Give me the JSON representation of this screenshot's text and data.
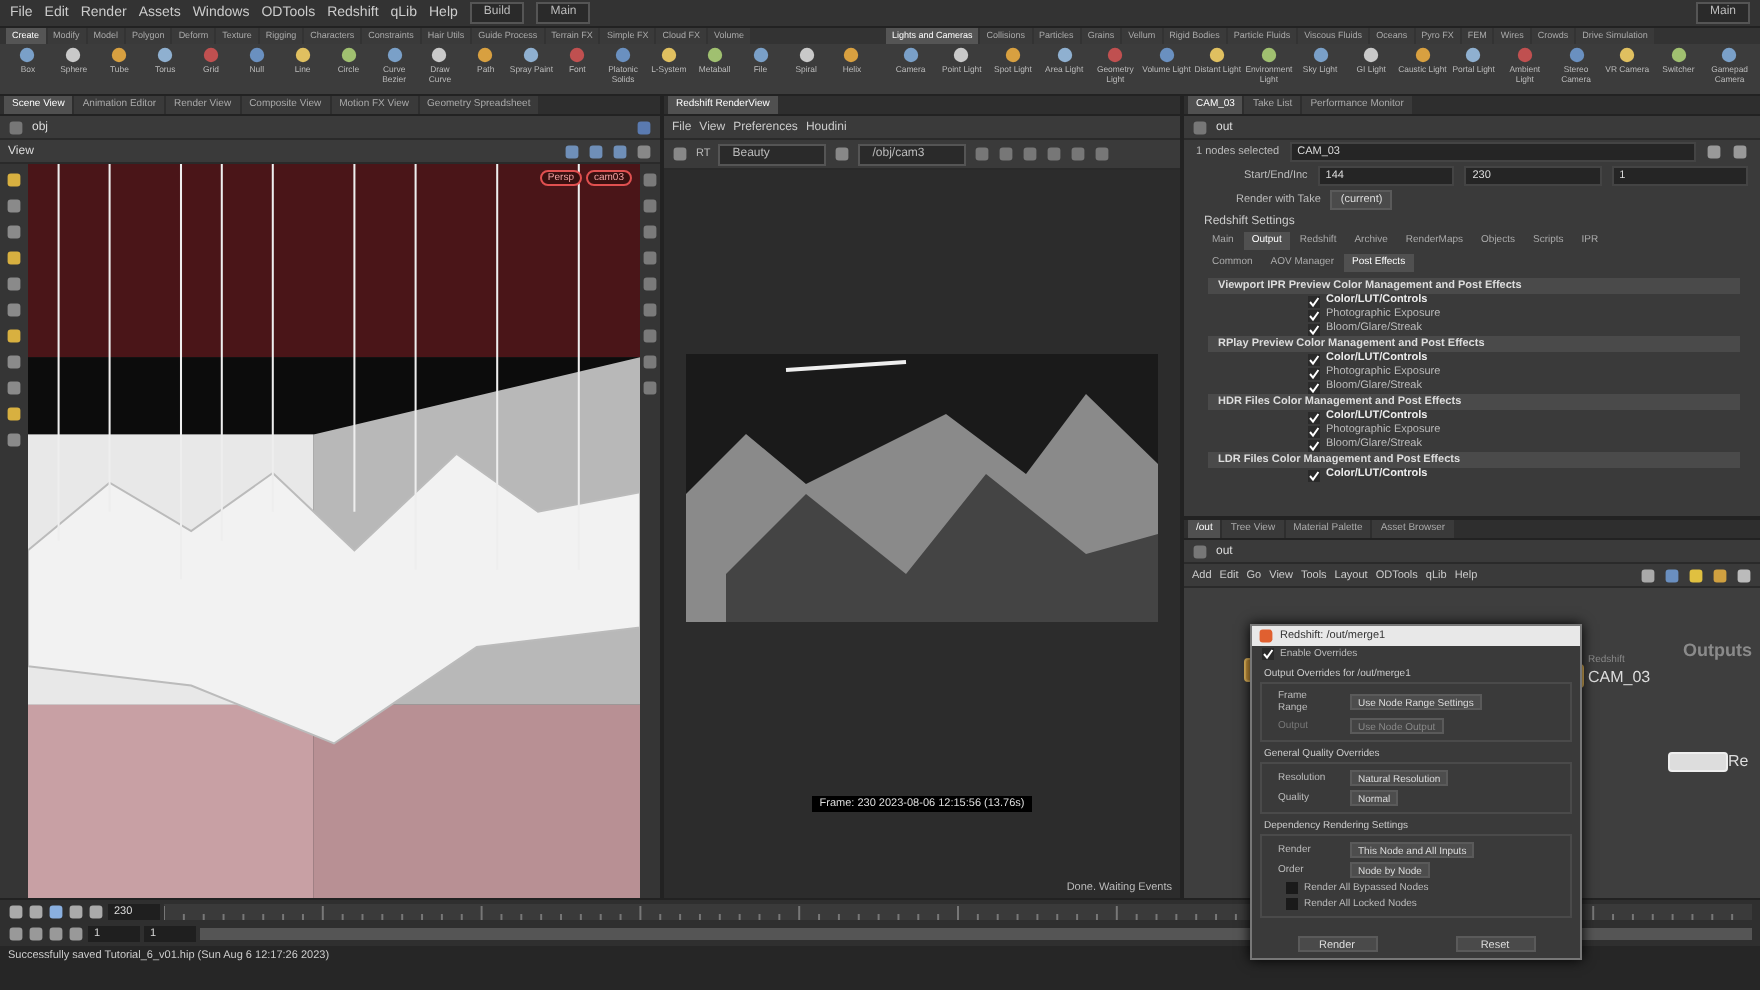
{
  "menubar": {
    "items": [
      "File",
      "Edit",
      "Render",
      "Assets",
      "Windows",
      "ODTools",
      "Redshift",
      "qLib",
      "Help"
    ],
    "desktop": "Build",
    "context": "Main",
    "right_context": "Main"
  },
  "shelf_left": {
    "tabs": [
      {
        "label": "Create",
        "selected": true
      },
      {
        "label": "Modify",
        "selected": false
      },
      {
        "label": "Model",
        "selected": false
      },
      {
        "label": "Polygon",
        "selected": false
      },
      {
        "label": "Deform",
        "selected": false
      },
      {
        "label": "Texture",
        "selected": false
      },
      {
        "label": "Rigging",
        "selected": false
      },
      {
        "label": "Characters",
        "selected": false
      },
      {
        "label": "Constraints",
        "selected": false
      },
      {
        "label": "Hair Utils",
        "selected": false
      },
      {
        "label": "Guide Process",
        "selected": false
      },
      {
        "label": "Terrain FX",
        "selected": false
      },
      {
        "label": "Simple FX",
        "selected": false
      },
      {
        "label": "Cloud FX",
        "selected": false
      },
      {
        "label": "Volume",
        "selected": false
      }
    ],
    "tools": [
      "Box",
      "Sphere",
      "Tube",
      "Torus",
      "Grid",
      "Null",
      "Line",
      "Circle",
      "Curve Bezier",
      "Draw Curve",
      "Path",
      "Spray Paint",
      "Font",
      "Platonic Solids",
      "L-System",
      "Metaball",
      "File",
      "Spiral",
      "Helix"
    ]
  },
  "shelf_right": {
    "tabs": [
      {
        "label": "Lights and Cameras",
        "selected": true
      },
      {
        "label": "Collisions",
        "selected": false
      },
      {
        "label": "Particles",
        "selected": false
      },
      {
        "label": "Grains",
        "selected": false
      },
      {
        "label": "Vellum",
        "selected": false
      },
      {
        "label": "Rigid Bodies",
        "selected": false
      },
      {
        "label": "Particle Fluids",
        "selected": false
      },
      {
        "label": "Viscous Fluids",
        "selected": false
      },
      {
        "label": "Oceans",
        "selected": false
      },
      {
        "label": "Pyro FX",
        "selected": false
      },
      {
        "label": "FEM",
        "selected": false
      },
      {
        "label": "Wires",
        "selected": false
      },
      {
        "label": "Crowds",
        "selected": false
      },
      {
        "label": "Drive Simulation",
        "selected": false
      }
    ],
    "tools": [
      "Camera",
      "Point Light",
      "Spot Light",
      "Area Light",
      "Geometry Light",
      "Volume Light",
      "Distant Light",
      "Environment Light",
      "Sky Light",
      "GI Light",
      "Caustic Light",
      "Portal Light",
      "Ambient Light",
      "Stereo Camera",
      "VR Camera",
      "Switcher",
      "Gamepad Camera"
    ]
  },
  "scene_pane": {
    "tabs": [
      {
        "label": "Scene View",
        "selected": true
      },
      {
        "label": "Animation Editor",
        "selected": false
      },
      {
        "label": "Render View",
        "selected": false
      },
      {
        "label": "Composite View",
        "selected": false
      },
      {
        "label": "Motion FX View",
        "selected": false
      },
      {
        "label": "Geometry Spreadsheet",
        "selected": false
      }
    ],
    "path": "obj",
    "view_label": "View",
    "badges": [
      "Persp",
      "cam03"
    ]
  },
  "render_pane": {
    "tabs": [
      {
        "label": "Redshift RenderView",
        "selected": true
      }
    ],
    "menu": [
      "File",
      "View",
      "Preferences",
      "Houdini"
    ],
    "rt": "RT",
    "aov": "Beauty",
    "camera": "/obj/cam3",
    "caption": "Frame: 230  2023-08-06  12:15:56  (13.76s)",
    "status": "Done. Waiting Events"
  },
  "params_pane": {
    "tabs": [
      {
        "label": "CAM_03",
        "selected": true
      },
      {
        "label": "Take List",
        "selected": false
      },
      {
        "label": "Performance Monitor",
        "selected": false
      }
    ],
    "path": "out",
    "selection": "1 nodes selected",
    "node": "CAM_03",
    "range_label": "Start/End/Inc",
    "range": [
      "144",
      "230",
      "1"
    ],
    "take_label": "Render with Take",
    "take": "(current)",
    "settings_title": "Redshift Settings",
    "tabs2": [
      {
        "label": "Main",
        "selected": false
      },
      {
        "label": "Output",
        "selected": true
      },
      {
        "label": "Redshift",
        "selected": false
      },
      {
        "label": "Archive",
        "selected": false
      },
      {
        "label": "RenderMaps",
        "selected": false
      },
      {
        "label": "Objects",
        "selected": false
      },
      {
        "label": "Scripts",
        "selected": false
      },
      {
        "label": "IPR",
        "selected": false
      }
    ],
    "subtabs": [
      {
        "label": "Common",
        "selected": false
      },
      {
        "label": "AOV Manager",
        "selected": false
      },
      {
        "label": "Post Effects",
        "selected": true
      }
    ],
    "groups": [
      {
        "title": "Viewport IPR Preview Color Management and Post Effects",
        "items": [
          {
            "label": "Color/LUT/Controls",
            "checked": true
          },
          {
            "label": "Photographic Exposure",
            "checked": true
          },
          {
            "label": "Bloom/Glare/Streak",
            "checked": true
          }
        ]
      },
      {
        "title": "RPlay Preview Color Management and Post Effects",
        "items": [
          {
            "label": "Color/LUT/Controls",
            "checked": true
          },
          {
            "label": "Photographic Exposure",
            "checked": true
          },
          {
            "label": "Bloom/Glare/Streak",
            "checked": true
          }
        ]
      },
      {
        "title": "HDR Files Color Management and Post Effects",
        "items": [
          {
            "label": "Color/LUT/Controls",
            "checked": true
          },
          {
            "label": "Photographic Exposure",
            "checked": true
          },
          {
            "label": "Bloom/Glare/Streak",
            "checked": true
          }
        ]
      },
      {
        "title": "LDR Files Color Management and Post Effects",
        "items": [
          {
            "label": "Color/LUT/Controls",
            "checked": true
          }
        ]
      }
    ]
  },
  "network_pane": {
    "tabs": [
      {
        "label": "/out",
        "selected": true
      },
      {
        "label": "Tree View",
        "selected": false
      },
      {
        "label": "Material Palette",
        "selected": false
      },
      {
        "label": "Asset Browser",
        "selected": false
      }
    ],
    "path": "out",
    "menu": [
      "Add",
      "Edit",
      "Go",
      "View",
      "Tools",
      "Layout",
      "ODTools",
      "qLib",
      "Help"
    ],
    "outputs_label": "Outputs",
    "nodes": [
      {
        "label": "CAM_03",
        "sublabel": "Redshift"
      },
      {
        "label": "Re"
      }
    ],
    "dialog": {
      "title": "Redshift: /out/merge1",
      "enable_label": "Enable Overrides",
      "enable": true,
      "sections": [
        {
          "title": "Output Overrides for /out/merge1",
          "fields": [
            {
              "label": "Frame Range",
              "value": "Use Node Range Settings",
              "disabled": false
            },
            {
              "label": "Output",
              "value": "Use Node Output",
              "disabled": true
            }
          ]
        },
        {
          "title": "General Quality Overrides",
          "fields": [
            {
              "label": "Resolution",
              "value": "Natural Resolution",
              "disabled": false
            },
            {
              "label": "Quality",
              "value": "Normal",
              "disabled": false
            }
          ]
        },
        {
          "title": "Dependency Rendering Settings",
          "fields": [
            {
              "label": "Render",
              "value": "This Node and All Inputs",
              "disabled": false
            },
            {
              "label": "Order",
              "value": "Node by Node",
              "disabled": false
            }
          ]
        }
      ],
      "checks": [
        {
          "label": "Render All Bypassed Nodes",
          "checked": false
        },
        {
          "label": "Render All Locked Nodes",
          "checked": false
        }
      ],
      "buttons": [
        "Render",
        "Reset"
      ]
    }
  },
  "timeline": {
    "frame": "230",
    "start": "1",
    "end": "1",
    "range_bar": {
      "level": 1
    }
  },
  "status_bar": {
    "message": "Successfully saved Tutorial_6_v01.hip (Sun Aug  6 12:17:26 2023)"
  }
}
